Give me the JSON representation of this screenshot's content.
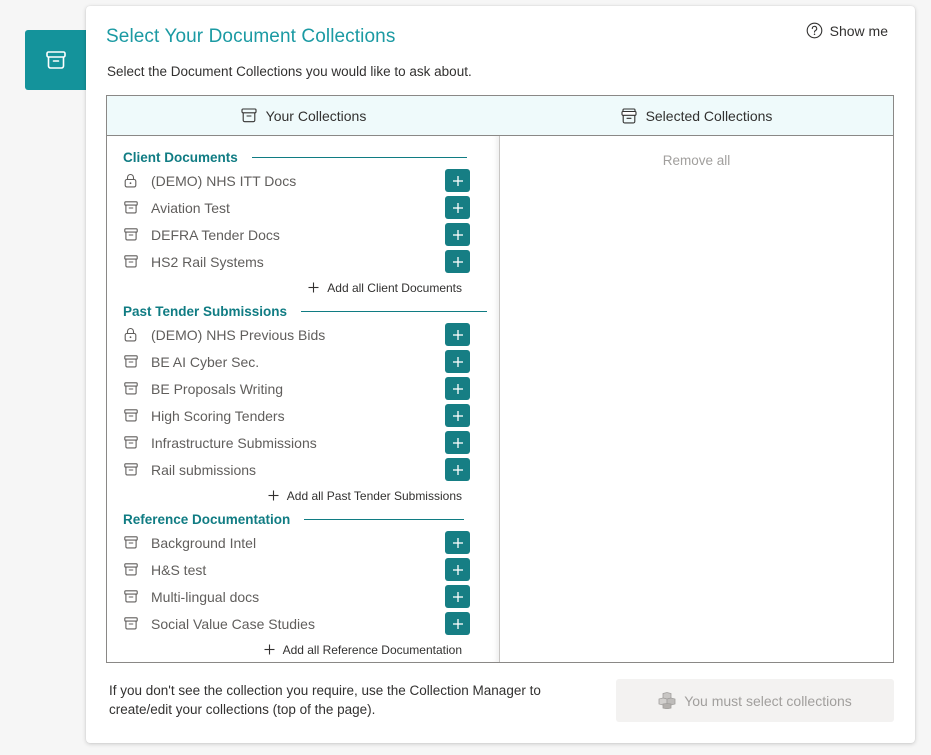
{
  "panel": {
    "title": "Select Your Document Collections",
    "show_me": "Show me",
    "subtitle": "Select the Document Collections you would like to ask about."
  },
  "columns": {
    "left_header": "Your Collections",
    "right_header": "Selected Collections",
    "remove_all": "Remove all"
  },
  "groups": [
    {
      "title": "Client Documents",
      "items": [
        {
          "label": "(DEMO) NHS ITT Docs",
          "icon": "lock-icon"
        },
        {
          "label": "Aviation Test",
          "icon": "archive-icon"
        },
        {
          "label": "DEFRA Tender Docs",
          "icon": "archive-icon"
        },
        {
          "label": "HS2 Rail Systems",
          "icon": "archive-icon"
        }
      ],
      "add_all": "Add all Client Documents"
    },
    {
      "title": "Past Tender Submissions",
      "items": [
        {
          "label": "(DEMO) NHS Previous Bids",
          "icon": "lock-icon"
        },
        {
          "label": "BE AI Cyber Sec.",
          "icon": "archive-icon"
        },
        {
          "label": "BE Proposals Writing",
          "icon": "archive-icon"
        },
        {
          "label": "High Scoring Tenders",
          "icon": "archive-icon"
        },
        {
          "label": "Infrastructure Submissions",
          "icon": "archive-icon"
        },
        {
          "label": "Rail submissions",
          "icon": "archive-icon"
        }
      ],
      "add_all": "Add all Past Tender Submissions"
    },
    {
      "title": "Reference Documentation",
      "items": [
        {
          "label": "Background Intel",
          "icon": "archive-icon"
        },
        {
          "label": "H&S test",
          "icon": "archive-icon"
        },
        {
          "label": "Multi-lingual docs",
          "icon": "archive-icon"
        },
        {
          "label": "Social Value Case Studies",
          "icon": "archive-icon"
        }
      ],
      "add_all": "Add all Reference Documentation"
    }
  ],
  "footer": {
    "help_text": "If you don't see the collection you require, use the Collection Manager to create/edit your collections (top of the page).",
    "submit_label": "You must select collections"
  },
  "colors": {
    "accent": "#1b9aa3",
    "add_button": "#167e84",
    "group_title": "#107c83",
    "header_bg": "#effafb"
  }
}
